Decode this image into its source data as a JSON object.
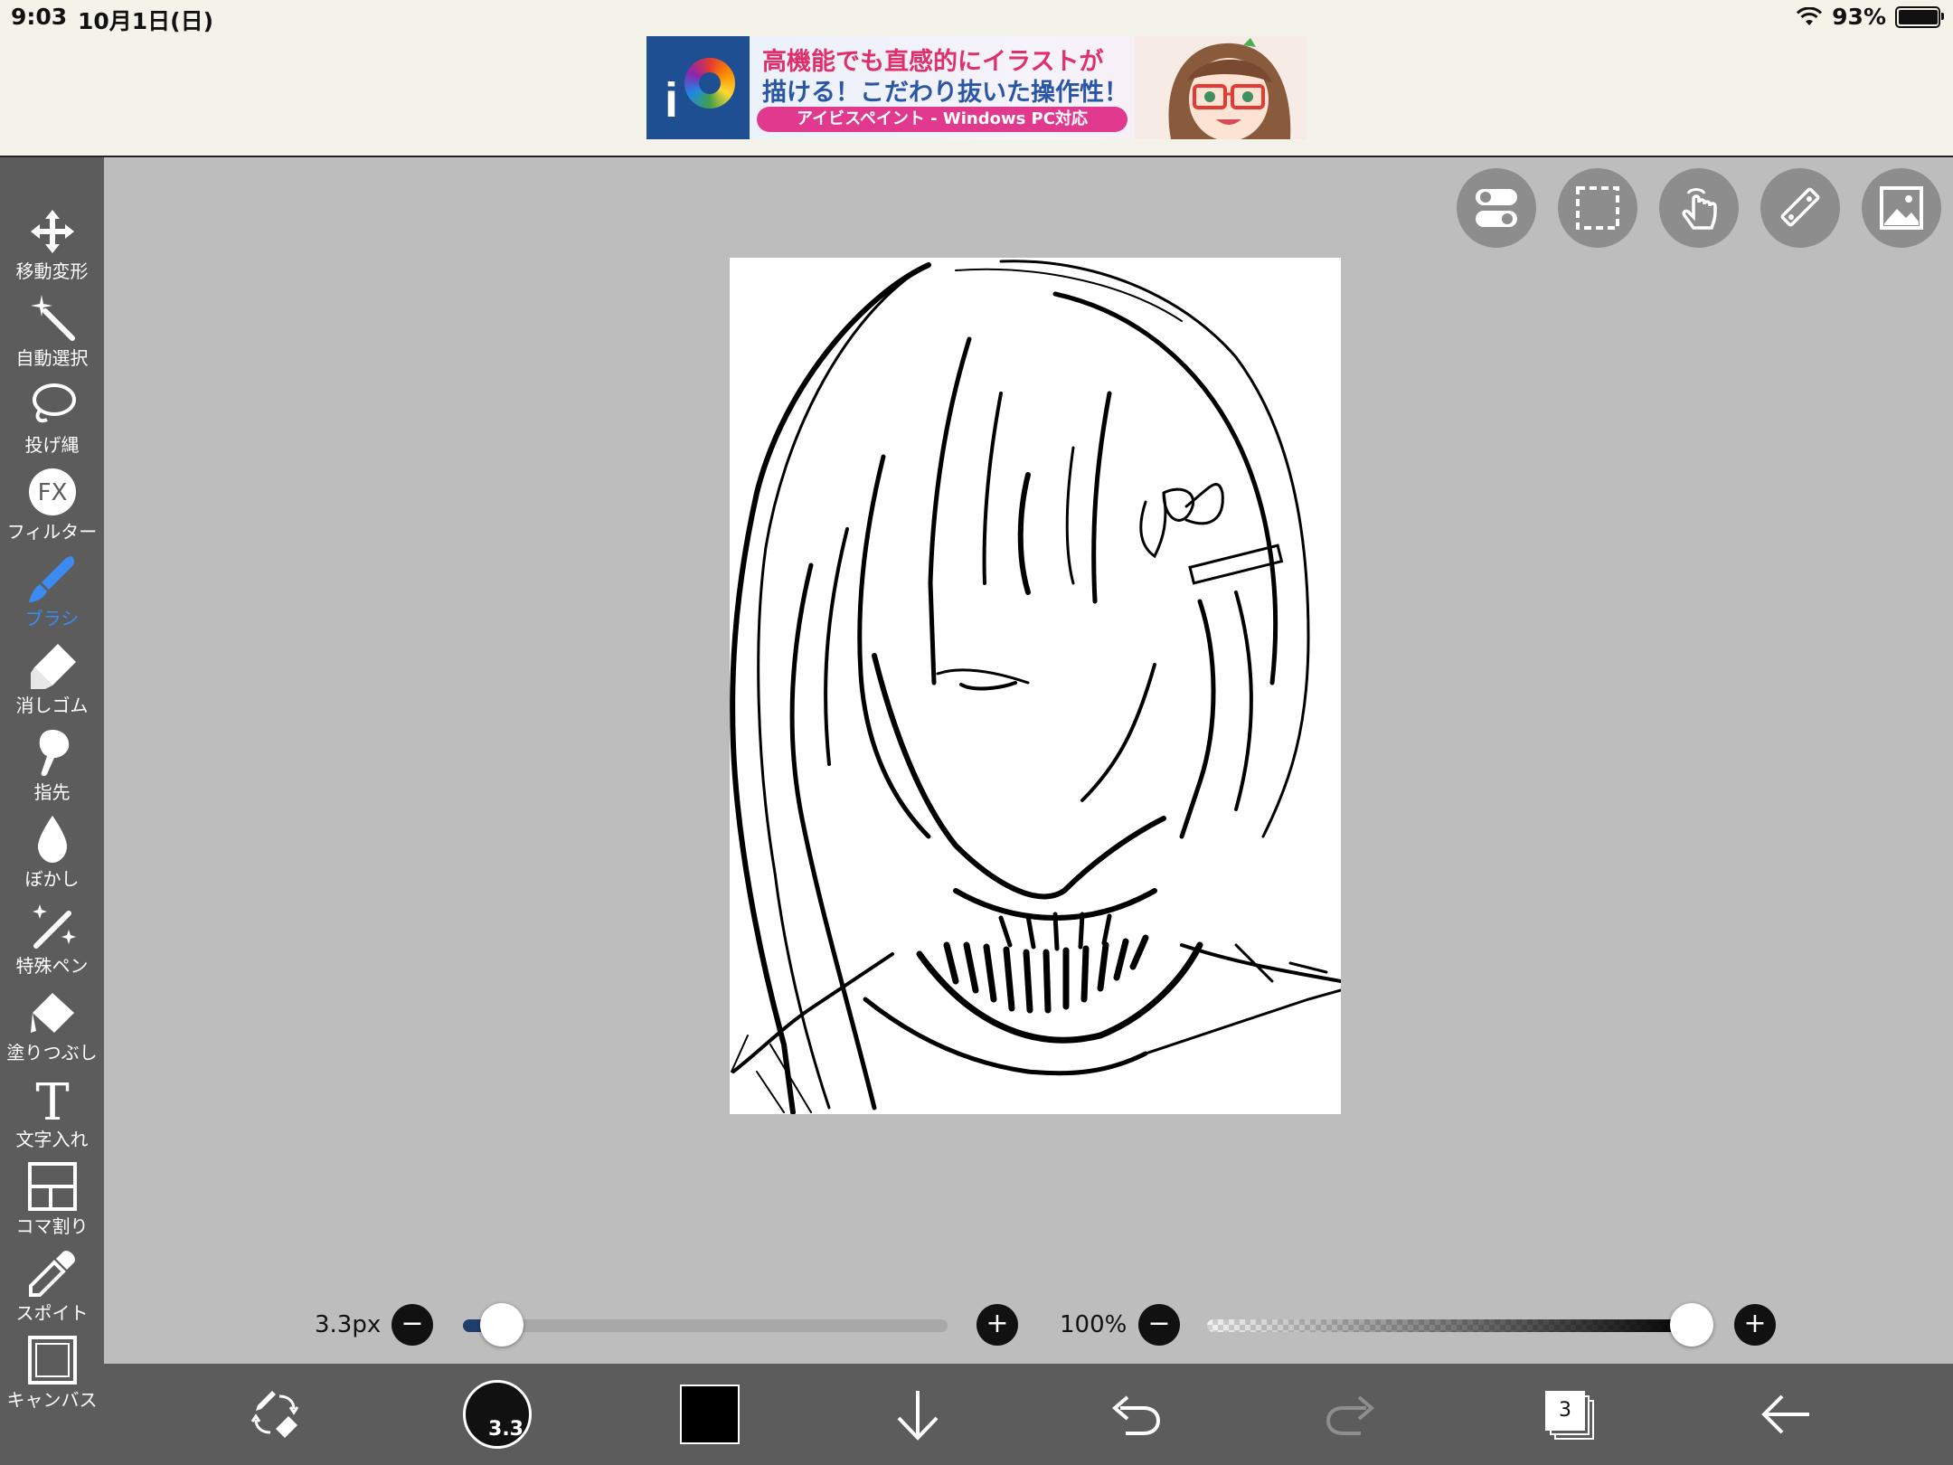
{
  "status_bar": {
    "time": "9:03",
    "date": "10月1日(日)",
    "battery_percent": "93%",
    "battery_level": 0.93
  },
  "ad": {
    "logo_letter": "i",
    "line1": "高機能でも直感的にイラストが",
    "line2": "描ける！こだわり抜いた操作性！",
    "bar_text": "アイビスペイント - Windows PC対応"
  },
  "toolbar": {
    "items": [
      {
        "label": "移動変形",
        "icon": "move-icon"
      },
      {
        "label": "自動選択",
        "icon": "magic-wand-icon"
      },
      {
        "label": "投げ縄",
        "icon": "lasso-icon"
      },
      {
        "label": "フィルター",
        "icon": "fx-icon",
        "icon_text": "FX"
      },
      {
        "label": "ブラシ",
        "icon": "brush-icon"
      },
      {
        "label": "消しゴム",
        "icon": "eraser-icon"
      },
      {
        "label": "指先",
        "icon": "finger-icon"
      },
      {
        "label": "ぼかし",
        "icon": "blur-drop-icon"
      },
      {
        "label": "特殊ペン",
        "icon": "special-pen-icon"
      },
      {
        "label": "塗りつぶし",
        "icon": "fill-bucket-icon"
      },
      {
        "label": "文字入れ",
        "icon": "text-icon",
        "icon_text": "T"
      },
      {
        "label": "コマ割り",
        "icon": "frame-divider-icon"
      },
      {
        "label": "スポイト",
        "icon": "eyedropper-icon"
      },
      {
        "label": "キャンバス",
        "icon": "canvas-icon"
      }
    ],
    "active_index": 4,
    "active_color": "#3b8bf2"
  },
  "top_buttons": [
    "toggle-icon",
    "selection-icon",
    "touch-icon",
    "ruler-icon",
    "reference-image-icon"
  ],
  "brush_size": {
    "label": "3.3px",
    "value": 3.3,
    "fraction": 0.08,
    "minus": "−",
    "plus": "+"
  },
  "opacity": {
    "label": "100%",
    "value": 100,
    "minus": "−",
    "plus": "+"
  },
  "bottom_bar": {
    "brush_preview_value": "3.3",
    "current_color": "#000000",
    "layer_count": "3",
    "icons": [
      "swap-brush-eraser-icon",
      "brush-preview",
      "color-swatch",
      "download-arrow-icon",
      "undo-icon",
      "redo-icon",
      "layers-icon",
      "back-arrow-icon"
    ]
  }
}
